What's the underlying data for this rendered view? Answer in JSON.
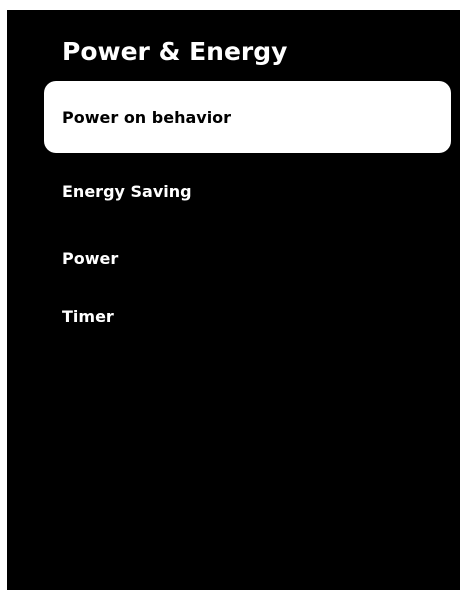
{
  "header": {
    "title": "Power & Energy"
  },
  "menu": {
    "items": [
      {
        "label": "Power on behavior",
        "selected": true
      },
      {
        "label": "Energy Saving",
        "selected": false
      },
      {
        "label": "Power",
        "selected": false
      },
      {
        "label": "Timer",
        "selected": false
      }
    ]
  },
  "colors": {
    "background": "#000000",
    "text": "#ffffff",
    "highlight": "#ffffff",
    "highlight_text": "#000000"
  }
}
